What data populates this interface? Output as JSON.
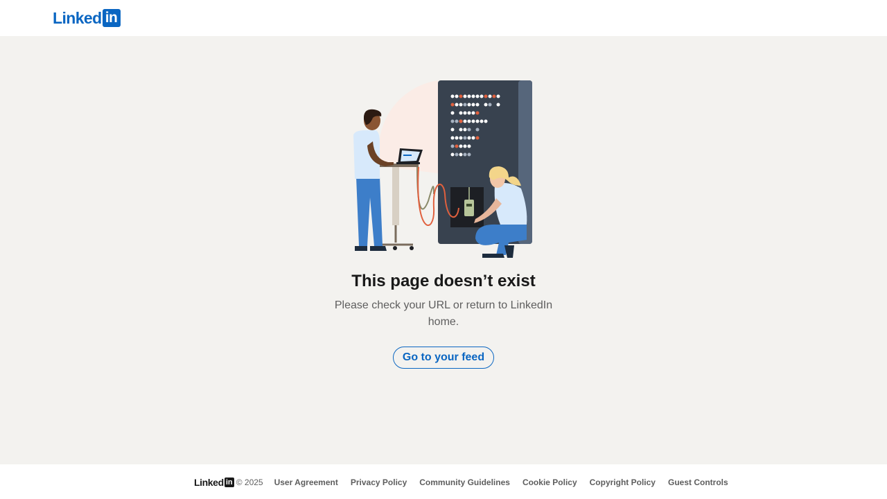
{
  "header": {
    "logo_word": "Linked",
    "logo_box": "in",
    "brand_color": "#0a66c2"
  },
  "main": {
    "illustration_icon": "server-repair-illustration",
    "title": "This page doesn’t exist",
    "message": "Please check your URL or return to LinkedIn home.",
    "button_label": "Go to your feed"
  },
  "footer": {
    "logo_word": "Linked",
    "logo_box": "in",
    "copyright": "© 2025",
    "links": [
      "User Agreement",
      "Privacy Policy",
      "Community Guidelines",
      "Cookie Policy",
      "Copyright Policy",
      "Guest Controls"
    ]
  },
  "colors": {
    "background": "#f3f2ef",
    "accent": "#0a66c2",
    "text": "#191919",
    "muted_text": "#5e5e5e"
  }
}
